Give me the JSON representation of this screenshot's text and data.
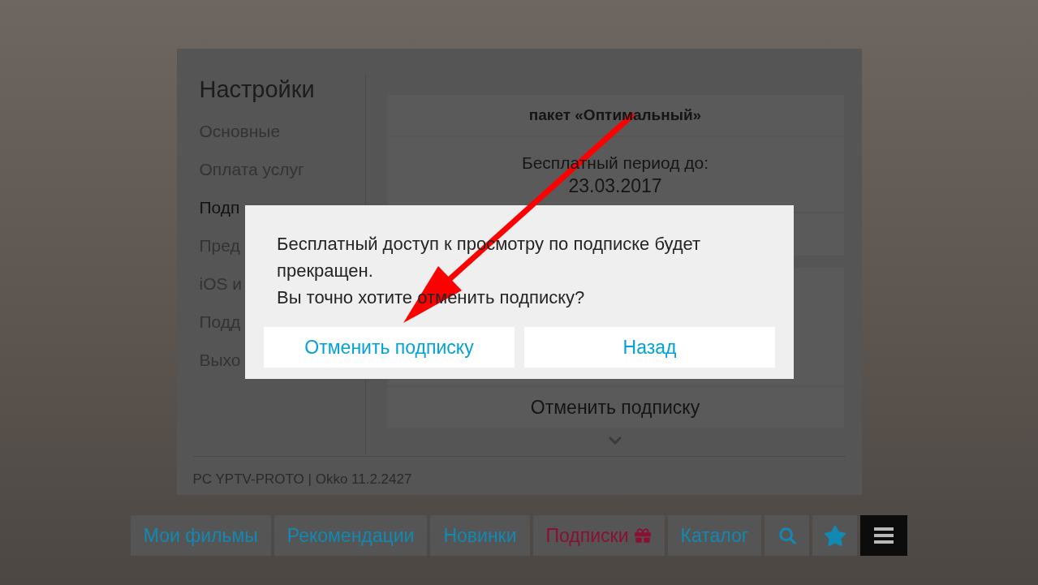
{
  "settings": {
    "title": "Настройки",
    "menu": [
      {
        "label": "Основные",
        "selected": false
      },
      {
        "label": "Оплата услуг",
        "selected": false
      },
      {
        "label": "Подп",
        "selected": true
      },
      {
        "label": "Пред",
        "selected": false
      },
      {
        "label": "iOS и",
        "selected": false
      },
      {
        "label": "Подд",
        "selected": false
      },
      {
        "label": "Выхо",
        "selected": false
      }
    ]
  },
  "subscription": {
    "package": "пакет «Оптимальный»",
    "free_period_label": "Бесплатный период до:",
    "free_period_date": "23.03.2017",
    "cancel_button": "Отменить подписку"
  },
  "footer": "PC YPTV-PROTO | Okko 11.2.2427",
  "dialog": {
    "message": "Бесплатный доступ к просмотру по подписке будет прекращен.",
    "question": "Вы точно хотите отменить подписку?",
    "buttons": [
      "Отменить подписку",
      "Назад"
    ]
  },
  "nav": [
    {
      "kind": "text",
      "label": "Мои фильмы",
      "selected": false
    },
    {
      "kind": "text",
      "label": "Рекомендации",
      "selected": false
    },
    {
      "kind": "text",
      "label": "Новинки",
      "selected": false
    },
    {
      "kind": "promo",
      "label": "Подписки",
      "selected": false
    },
    {
      "kind": "text",
      "label": "Каталог",
      "selected": false
    },
    {
      "kind": "search",
      "selected": false
    },
    {
      "kind": "favorites",
      "selected": false
    },
    {
      "kind": "menu",
      "selected": true
    }
  ]
}
